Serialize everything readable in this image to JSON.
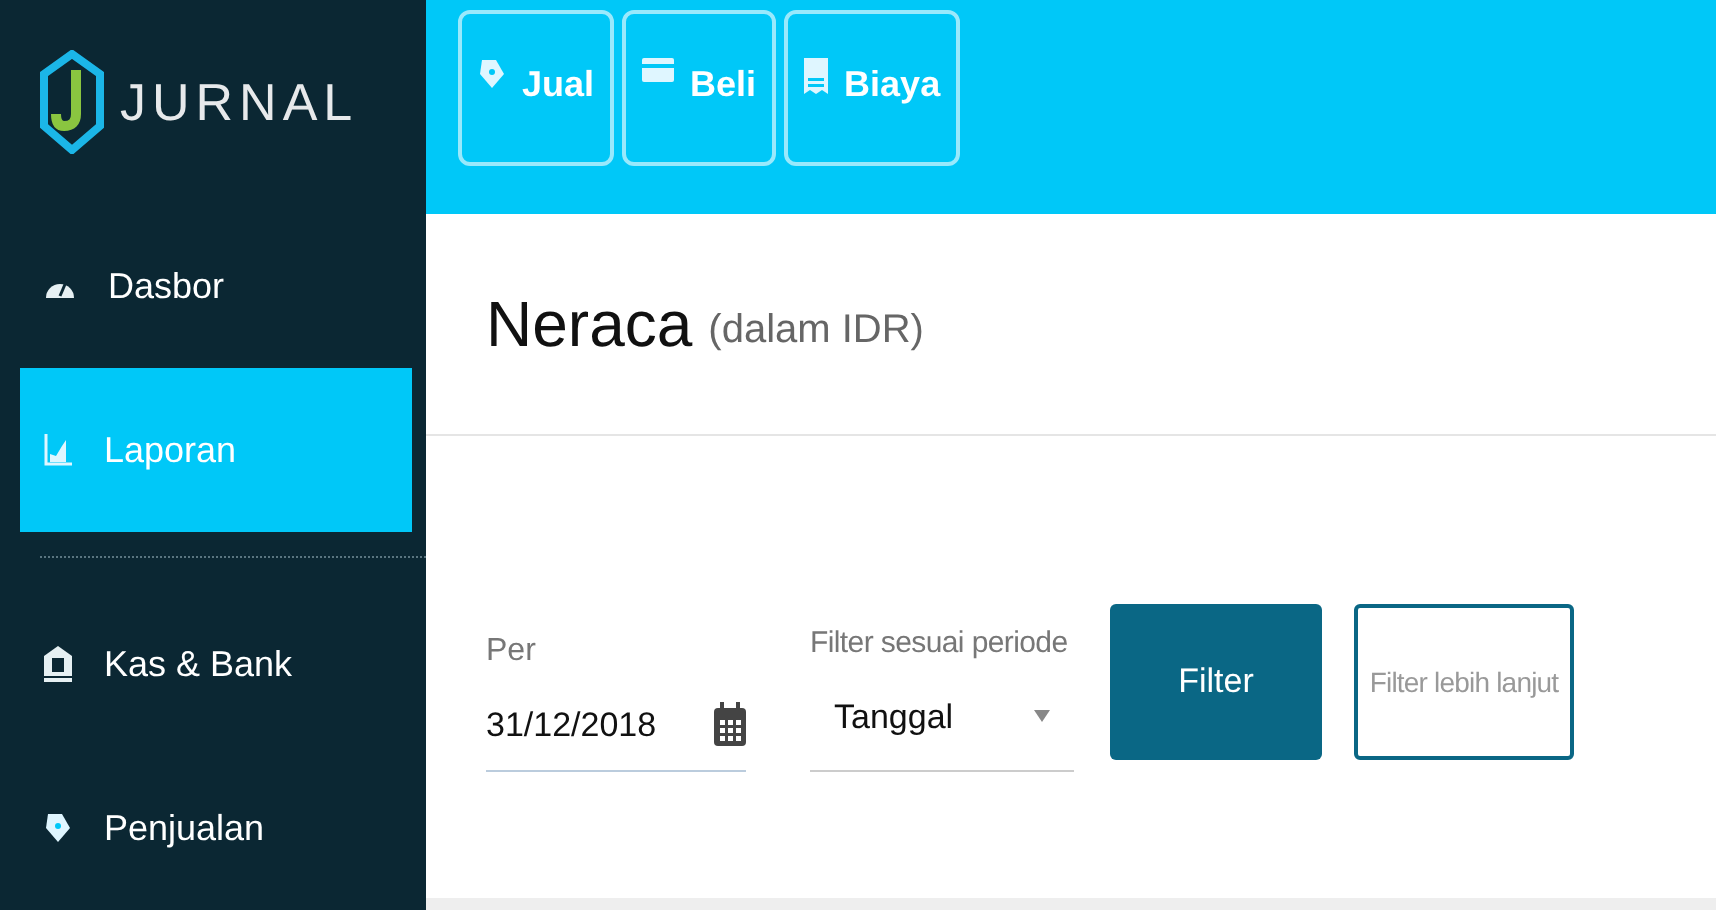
{
  "logo": {
    "text": "JURNAL"
  },
  "quick_actions": [
    {
      "label": "Jual",
      "kind": "tag"
    },
    {
      "label": "Beli",
      "kind": "card"
    },
    {
      "label": "Biaya",
      "kind": "receipt"
    }
  ],
  "sidebar": {
    "items": [
      {
        "label": "Dasbor",
        "kind": "gauge",
        "selected": false,
        "divider_after": false
      },
      {
        "label": "Laporan",
        "kind": "chart",
        "selected": true,
        "divider_after": true
      },
      {
        "label": "Kas & Bank",
        "kind": "bank",
        "selected": false,
        "divider_after": false
      },
      {
        "label": "Penjualan",
        "kind": "tag",
        "selected": false,
        "divider_after": false
      }
    ]
  },
  "page": {
    "title": "Neraca",
    "subtitle": "(dalam IDR)"
  },
  "filters": {
    "date": {
      "label": "Per",
      "value": "31/12/2018"
    },
    "period": {
      "label": "Filter sesuai periode",
      "value": "Tanggal"
    },
    "buttons": [
      {
        "label": "Filter",
        "kind": "primary"
      },
      {
        "label": "Filter lebih lanjut",
        "kind": "outline"
      }
    ]
  }
}
